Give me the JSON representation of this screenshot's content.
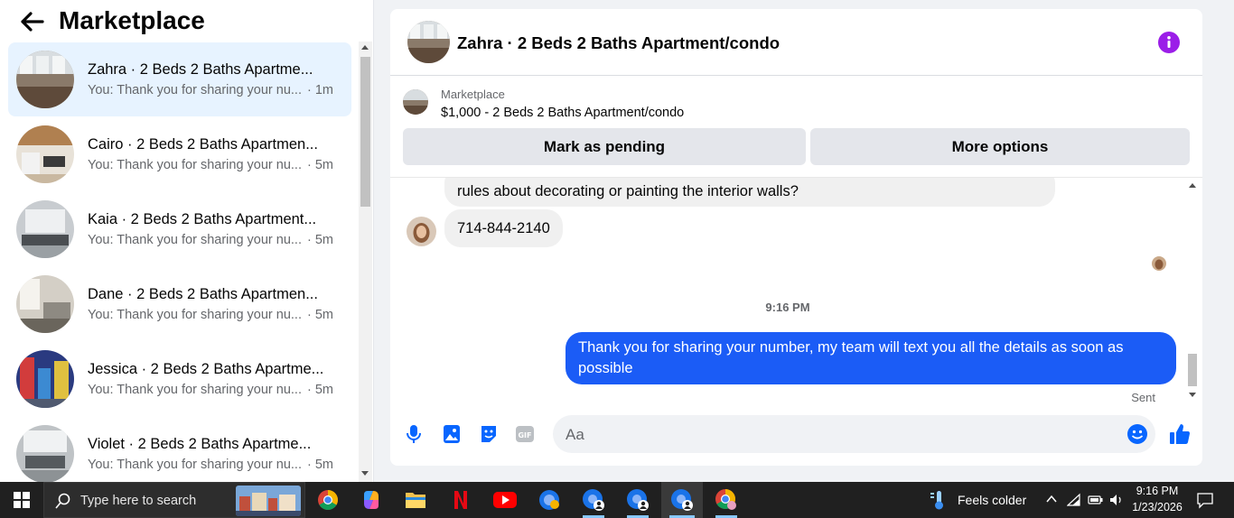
{
  "sidebar": {
    "title": "Marketplace",
    "conversations": [
      {
        "name": "Zahra · 2 Beds 2 Baths Apartme...",
        "preview": "You: Thank you for sharing your nu...",
        "time": "· 1m"
      },
      {
        "name": "Cairo · 2 Beds 2 Baths Apartmen...",
        "preview": "You: Thank you for sharing your nu...",
        "time": "· 5m"
      },
      {
        "name": "Kaia · 2 Beds 2 Baths Apartment...",
        "preview": "You: Thank you for sharing your nu...",
        "time": "· 5m"
      },
      {
        "name": "Dane · 2 Beds 2 Baths Apartmen...",
        "preview": "You: Thank you for sharing your nu...",
        "time": "· 5m"
      },
      {
        "name": "Jessica · 2 Beds 2 Baths Apartme...",
        "preview": "You: Thank you for sharing your nu...",
        "time": "· 5m"
      },
      {
        "name": "Violet · 2 Beds 2 Baths Apartme...",
        "preview": "You: Thank you for sharing your nu...",
        "time": "· 5m"
      }
    ]
  },
  "chat": {
    "title": "Zahra · 2 Beds 2 Baths Apartment/condo",
    "marketplace_label": "Marketplace",
    "listing": "$1,000 - 2 Beds 2 Baths Apartment/condo",
    "mark_pending": "Mark as pending",
    "more_options": "More options",
    "msg_partial": "rules about decorating or painting the interior walls?",
    "msg_phone": "714-844-2140",
    "timestamp": "9:16 PM",
    "msg_out_line1": "Thank you for  sharing your number, my team will text you all the details as soon as",
    "msg_out_line2": "possible",
    "sent_label": "Sent",
    "input_placeholder": "Aa"
  },
  "taskbar": {
    "search_placeholder": "Type here to search",
    "weather": "Feels colder",
    "time": "9:16 PM",
    "date": "1/23/2026"
  },
  "colors": {
    "accent": "#1b5cf6",
    "info": "#9b1ee8",
    "active_row": "#e7f3ff"
  }
}
